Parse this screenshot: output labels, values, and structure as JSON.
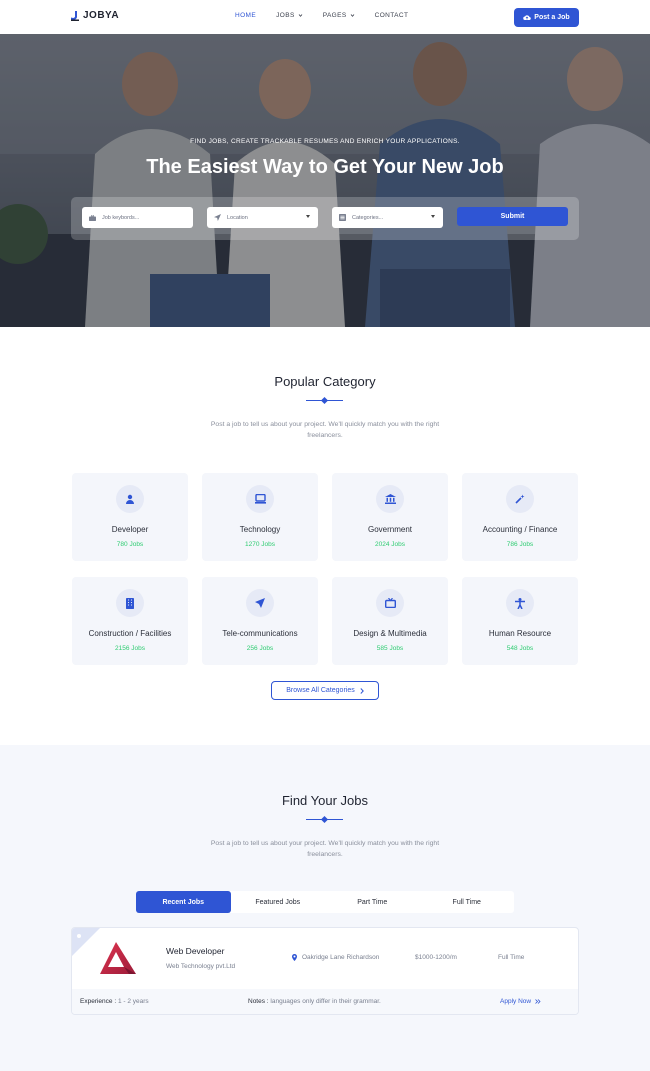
{
  "header": {
    "logo": "JOBYA",
    "nav": [
      {
        "label": "HOME",
        "active": true,
        "dropdown": false
      },
      {
        "label": "JOBS",
        "active": false,
        "dropdown": true
      },
      {
        "label": "PAGES",
        "active": false,
        "dropdown": true
      },
      {
        "label": "CONTACT",
        "active": false,
        "dropdown": false
      }
    ],
    "post_button": "Post a Job"
  },
  "hero": {
    "subtitle": "FIND JOBS, CREATE TRACKABLE RESUMES AND ENRICH YOUR APPLICATIONS.",
    "title": "The Easiest Way to Get Your New Job",
    "search": {
      "keywords_placeholder": "Job keybords...",
      "location_placeholder": "Location",
      "categories_placeholder": "Categories...",
      "submit": "Submit"
    }
  },
  "popular": {
    "title": "Popular Category",
    "description": "Post a job to tell us about your project. We'll quickly match you with the right freelancers.",
    "categories": [
      {
        "name": "Developer",
        "count": "780 Jobs",
        "icon": "user-icon"
      },
      {
        "name": "Technology",
        "count": "1270 Jobs",
        "icon": "monitor-icon"
      },
      {
        "name": "Government",
        "count": "2024 Jobs",
        "icon": "bank-icon"
      },
      {
        "name": "Accounting / Finance",
        "count": "786 Jobs",
        "icon": "magic-wand-icon"
      },
      {
        "name": "Construction / Facilities",
        "count": "2156 Jobs",
        "icon": "building-icon"
      },
      {
        "name": "Tele-communications",
        "count": "256 Jobs",
        "icon": "send-icon"
      },
      {
        "name": "Design & Multimedia",
        "count": "585 Jobs",
        "icon": "tv-icon"
      },
      {
        "name": "Human Resource",
        "count": "548 Jobs",
        "icon": "person-icon"
      }
    ],
    "browse_button": "Browse All Categories"
  },
  "find_jobs": {
    "title": "Find Your Jobs",
    "description": "Post a job to tell us about your project. We'll quickly match you with the right freelancers.",
    "tabs": [
      {
        "label": "Recent Jobs",
        "active": true
      },
      {
        "label": "Featured Jobs",
        "active": false
      },
      {
        "label": "Part Time",
        "active": false
      },
      {
        "label": "Full Time",
        "active": false
      }
    ],
    "job": {
      "title": "Web Developer",
      "company": "Web Technology pvt.Ltd",
      "location": "Oakridge Lane Richardson",
      "salary": "$1000-1200/m",
      "type": "Full Time",
      "experience_label": "Experience :",
      "experience_value": "1 - 2 years",
      "notes_label": "Notes :",
      "notes_value": "languages only differ in their grammar.",
      "apply": "Apply Now"
    }
  },
  "colors": {
    "primary": "#2f55d4",
    "success": "#2ecc71",
    "card_bg": "#f4f6fb",
    "section_bg": "#f5f7fc"
  }
}
